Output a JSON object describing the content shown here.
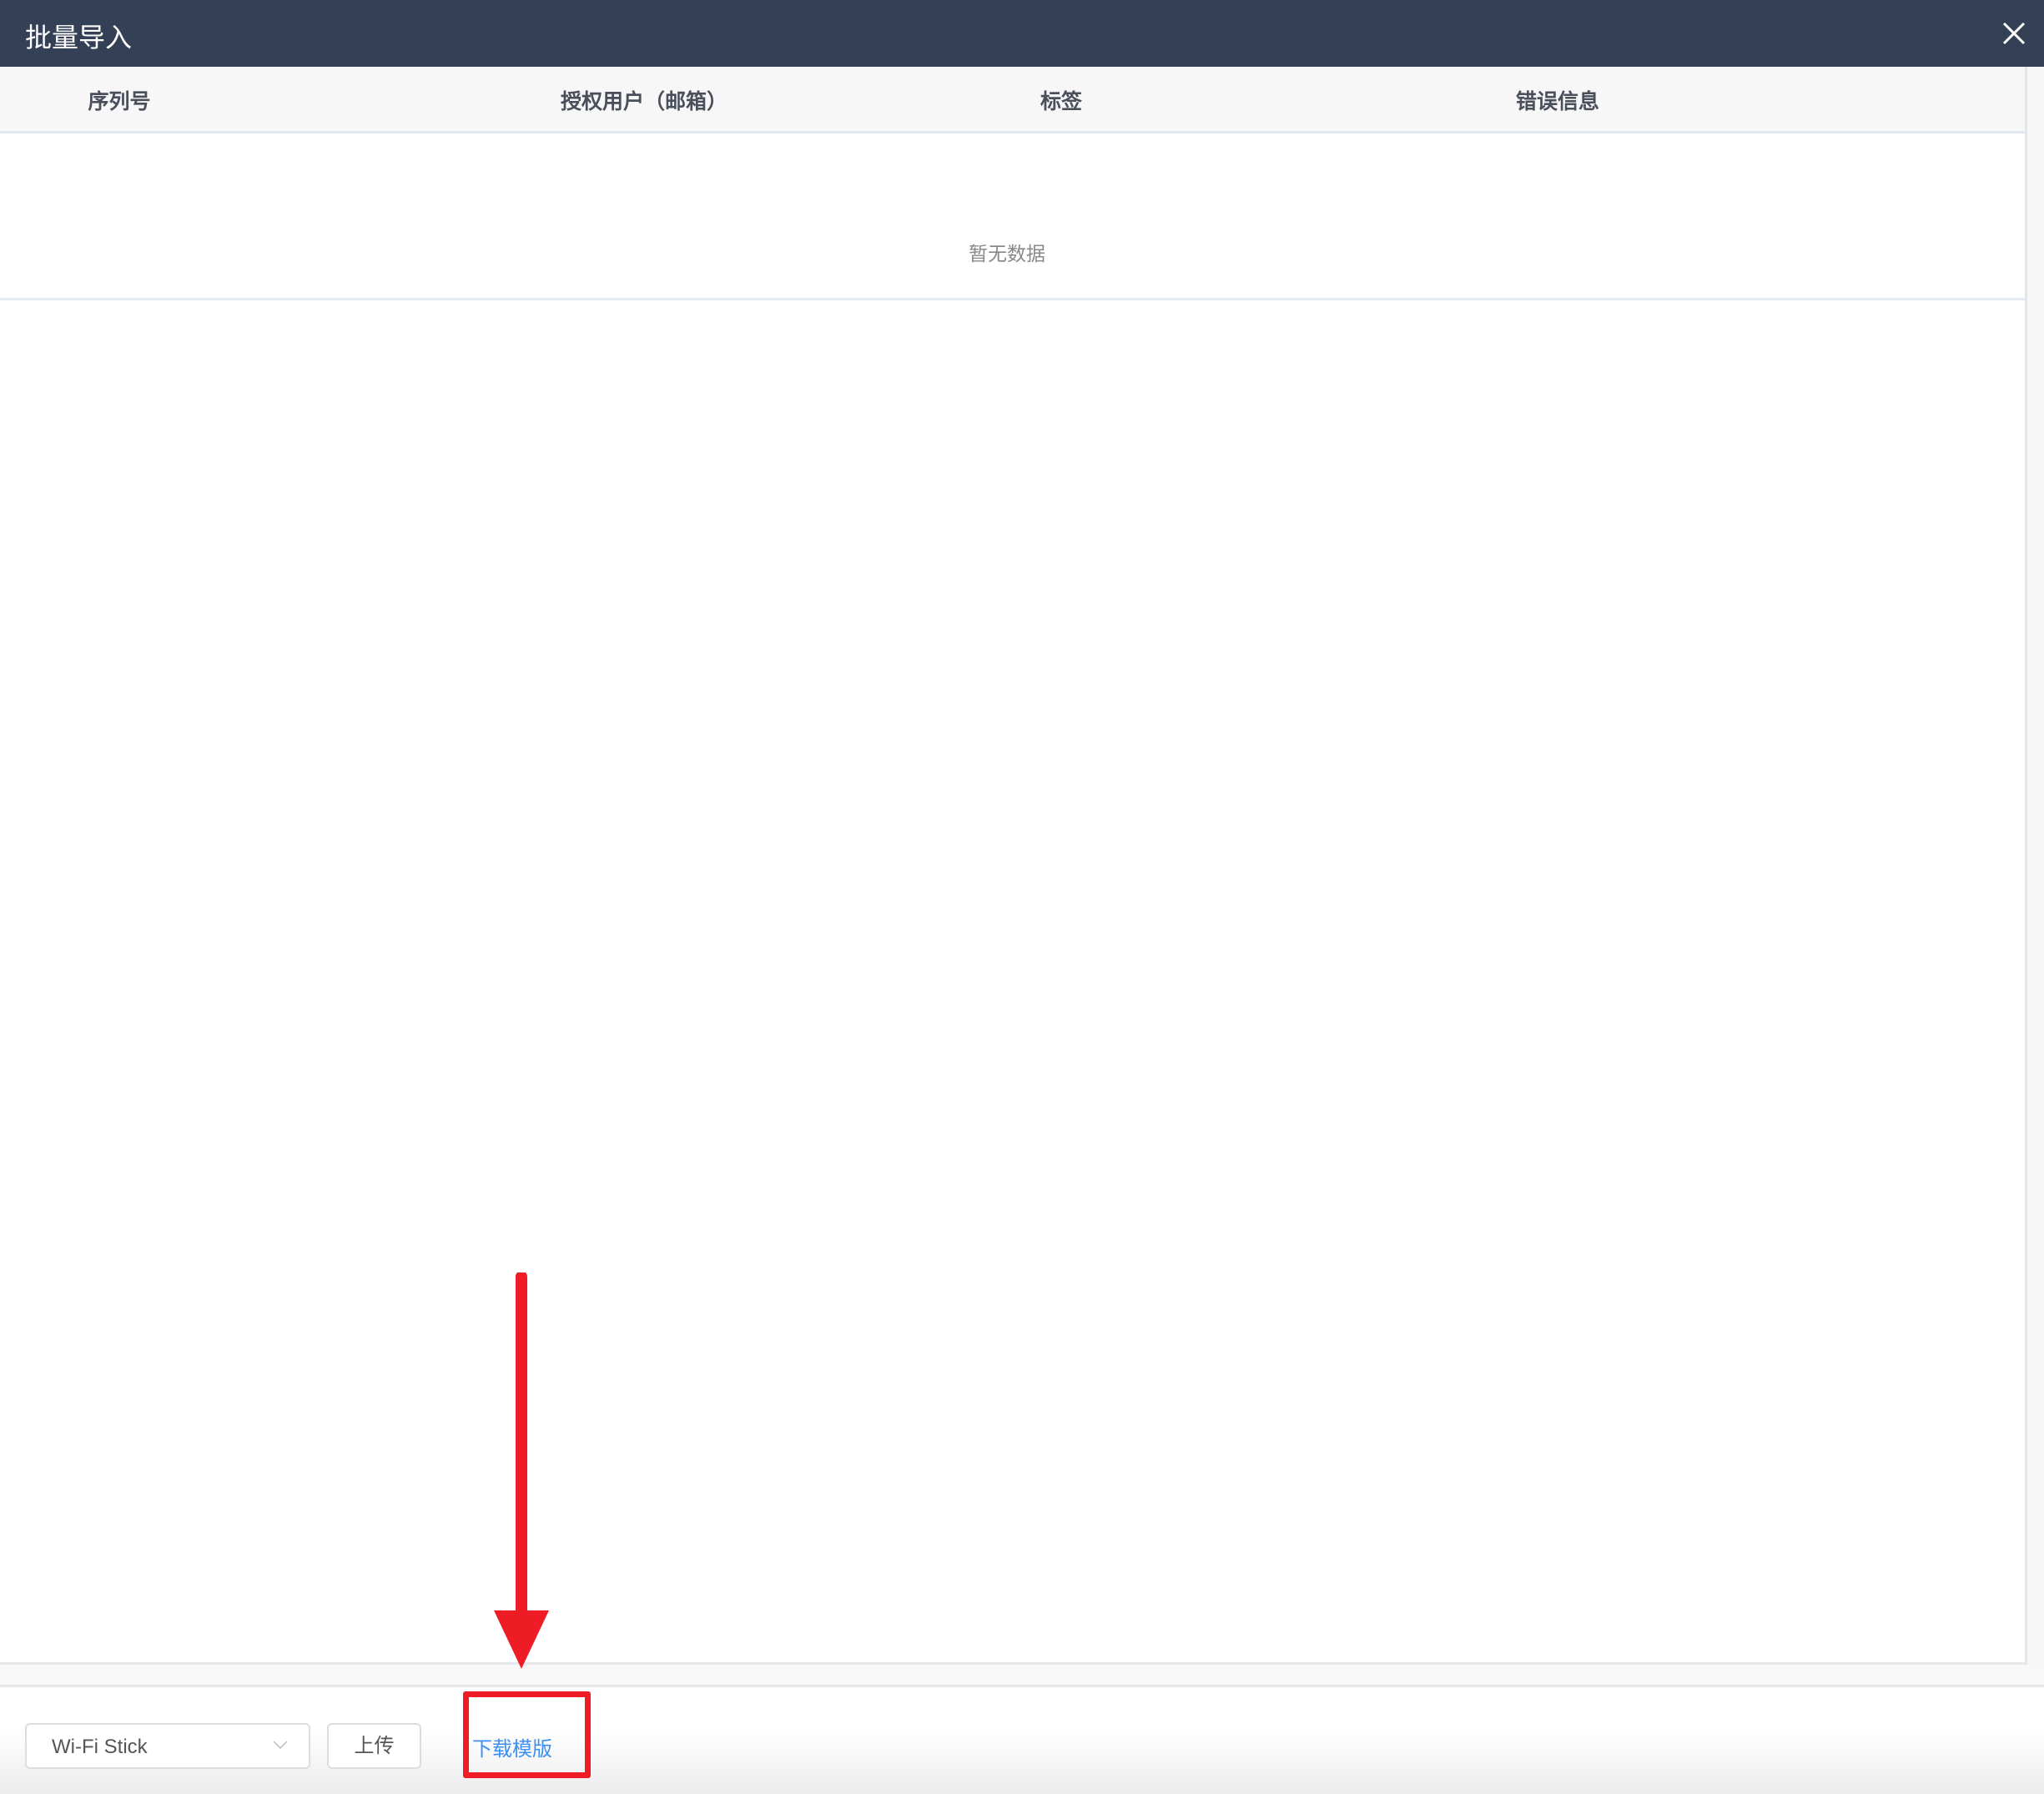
{
  "dialog": {
    "title": "批量导入"
  },
  "table": {
    "columns": [
      "序列号",
      "授权用户（邮箱）",
      "标签",
      "错误信息"
    ],
    "empty_text": "暂无数据"
  },
  "footer": {
    "device_select": "Wi-Fi Stick",
    "upload_label": "上传",
    "download_template_label": "下载模版"
  },
  "colors": {
    "header_bg": "#344055",
    "link": "#3d8ff2",
    "annotation": "#ee1c25"
  }
}
